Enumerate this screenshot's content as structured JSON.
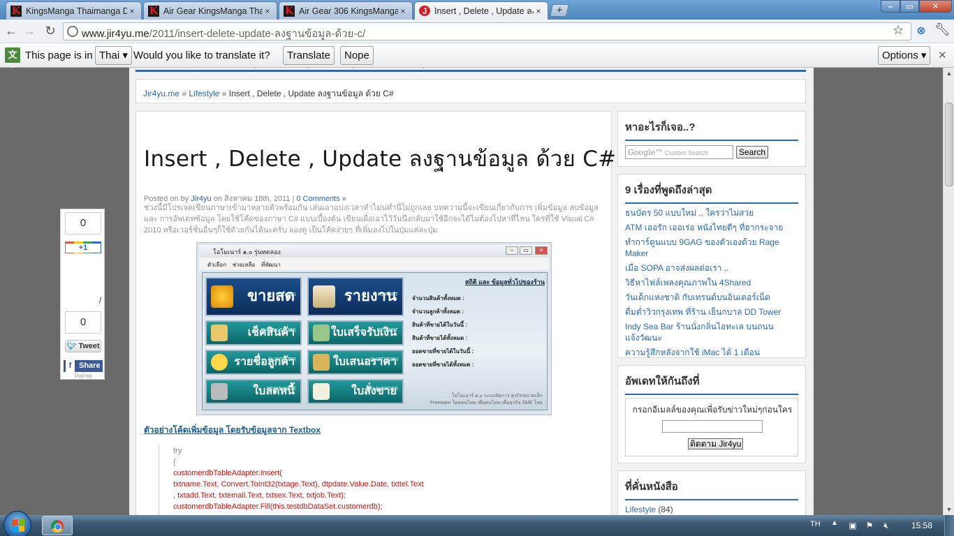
{
  "browser": {
    "tabs": [
      {
        "title": "KingsManga Thaimanga Dc",
        "icon": "kingsmanga-k-icon"
      },
      {
        "title": "Air Gear KingsManga Thair",
        "icon": "kingsmanga-k-icon"
      },
      {
        "title": "Air Gear 306 KingsManga Th",
        "icon": "kingsmanga-k-icon"
      },
      {
        "title": "Insert , Delete , Update ลงฐาน",
        "icon": "jir4yu-j-icon"
      }
    ],
    "tab_close_glyph": "×",
    "new_tab_glyph": "+",
    "url_host": "www.jir4yu.me",
    "url_path": "/2011/insert-delete-update-ลงฐานข้อมูล-ด้วย-c/"
  },
  "translate_bar": {
    "prefix": "This page is in",
    "language": "Thai",
    "question": "Would you like to translate it?",
    "translate_label": "Translate",
    "nope_label": "Nope",
    "options_label": "Options"
  },
  "breadcrumb": {
    "home": "Jir4yu.me",
    "separator": "»",
    "category": "Lifestyle",
    "current": "Insert , Delete , Update ลงฐานข้อมูล ด้วย C#"
  },
  "post": {
    "title": "Insert , Delete , Update ลงฐานข้อมูล ด้วย C#",
    "meta_posted_on": "Posted on",
    "meta_by": "by",
    "author": "Jir4yu",
    "meta_on": "on",
    "date": "สิงหาคม 18th, 2011",
    "meta_pipe": "|",
    "comments": "0 Comments »",
    "intro": "ช่วงนี้มีโปรเจคเขียนภาษาเข้ามาหลายตัวพร้อมกัน เล่นเอาแบ่งเวลาทำไม่นทำนี่ไม่ถูกเลย บทความนี้จะเขียนเกี่ยวกับการ เพิ่มข้อมูล ลบข้อมูล และ การอัพเดทข้อมูล โดยใช้โค้ดของภาษา C# แบบเบื้องต้น เขียนเผื่อเอาไว้วันนึงกลับมาใช้อีกจะได้ไม่ต้องไปหาที่ไหน ใครที่ใช้ Visual C# 2010 หรือเวอร์ชั่นอื่นๆก็ใช้ด้วยกันได้นะครับ ลองดู เป็นโค้ดง่ายๆ ที่เพิ่มลงไปในปุ่มแต่ละปุ่ม",
    "code_link": "ตัวอย่างโค้ดเพิ่มข้อมูล โดยรับข้อมูลจาก Textbox"
  },
  "app_screenshot": {
    "window_title": "โอโมเนาร์ ๑.๐ รุ่นทดลอง",
    "menu": [
      "ตัวเลือก",
      "ช่วยเหลือ",
      "ที่พัฒนา"
    ],
    "tiles": [
      {
        "label": "ขายสด",
        "sub": "BIILLING"
      },
      {
        "label": "รายงาน",
        "sub": "REPORT"
      },
      {
        "label": "เช็คสินค้า",
        "sub": "CHECK STOCK"
      },
      {
        "label": "ใบเสร็จรับเงิน",
        "sub": "RECEIPT"
      },
      {
        "label": "รายชื่อลูกค้า",
        "sub": "CUSTOMER"
      },
      {
        "label": "ใบเสนอราคา",
        "sub": "QUOTATION"
      },
      {
        "label": "ใบลดหนี้",
        "sub": "DEBIT NOTE"
      },
      {
        "label": "ใบสั่งขาย",
        "sub": "SALE ORDER"
      }
    ],
    "stats_title": "สถิติ และ ข้อมูลทั่วไปของร้าน",
    "stats": [
      "จำนวนสินค้าทั้งหมด :",
      "จำนวนลูกค้าทั้งหมด :",
      "สินค้าที่ขายได้ในวันนี้ :",
      "สินค้าที่ขายได้ทั้งหมด :",
      "ยอดขายที่ขายได้ในวันนี้ :",
      "ยอดขายที่ขายได้ทั้งหมด :"
    ],
    "footer_line1": "โอโมเนาร์ ๑.๐ ระบบจัดการ ธุรกิจขนาดเล็ก",
    "footer_line2": "Freeware โดยคนไทย เพื่อคนไทย เพื่อธุรกิจ SME ไทย"
  },
  "code": [
    {
      "text": "try",
      "red": false
    },
    {
      "text": "{",
      "red": false
    },
    {
      "text": "customerdbTableAdapter.Insert(",
      "red": true
    },
    {
      "text": "txtname.Text, Convert.ToInt32(txtage.Text), dtpdate.Value.Date, txttel.Text",
      "red": true
    },
    {
      "text": ", txtadd.Text, txtemail.Text, txtsex.Text, txtjob.Text);",
      "red": true
    },
    {
      "text": "customerdbTableAdapter.Fill(this.testdbDataSet.customerdb);",
      "red": true
    }
  ],
  "sidebar": {
    "search_title": "หาอะไรก็เจอ..?",
    "search_google": "Google™",
    "search_placeholder": "Custom Search",
    "search_button": "Search",
    "latest_title": "9 เรื่องที่พูดถึงล่าสุด",
    "latest": [
      "ธนบัตร 50 แบบใหม่ .. ใครว่าไม่สวย",
      "ATM เออรัก เออเร่อ หนังไทยดีๆ ที่ฮากระจาย",
      "ทำการ์ตูนแบบ 9GAG ของตัวเองด้วย Rage Maker",
      "เมื่อ SOPA อาจส่งผลต่อเรา ..",
      "วิธีหาไฟล์เพลงคุณภาพใน 4Shared",
      "วันเด็กแห่งชาติ กับเทรนด์บนอินเตอร์เน็ต",
      "ดื่มด่ำวิวกรุงเทพ ที่ร้าน เย็นกบาล DD Tower",
      "Indy Sea Bar ร้านนั่งกลิ่นไอทะเล บนถนนแจ้งวัฒนะ",
      "ความรู้สึกหลังจากใช้ iMac ได้ 1 เดือน"
    ],
    "subscribe_title": "อัพเดทให้กันถึงที่",
    "subscribe_label": "กรอกอีเมลล์ของคุณเพื่อรับข่าวใหม่ๆก่อนใคร",
    "follow_button": "ติดตาม Jir4yu",
    "categories_title": "ที่คั่นหนังสือ",
    "category_name": "Lifestyle",
    "category_count": "(84)"
  },
  "share_panel": {
    "plusone_count": "0",
    "plusone_label": "+1",
    "tweet_count": "0",
    "tweet_label": "Tweet",
    "share_label": "Share",
    "digg_text": "DiggDigg",
    "mark": "/"
  },
  "taskbar": {
    "language": "TH",
    "tray_arrow": "▲",
    "clock": "15:58"
  },
  "colors": {
    "link": "#2a6ab3",
    "accent_rule": "#2a6ab3",
    "code_red": "#d21010",
    "page_bg": "#6a6a6a"
  }
}
